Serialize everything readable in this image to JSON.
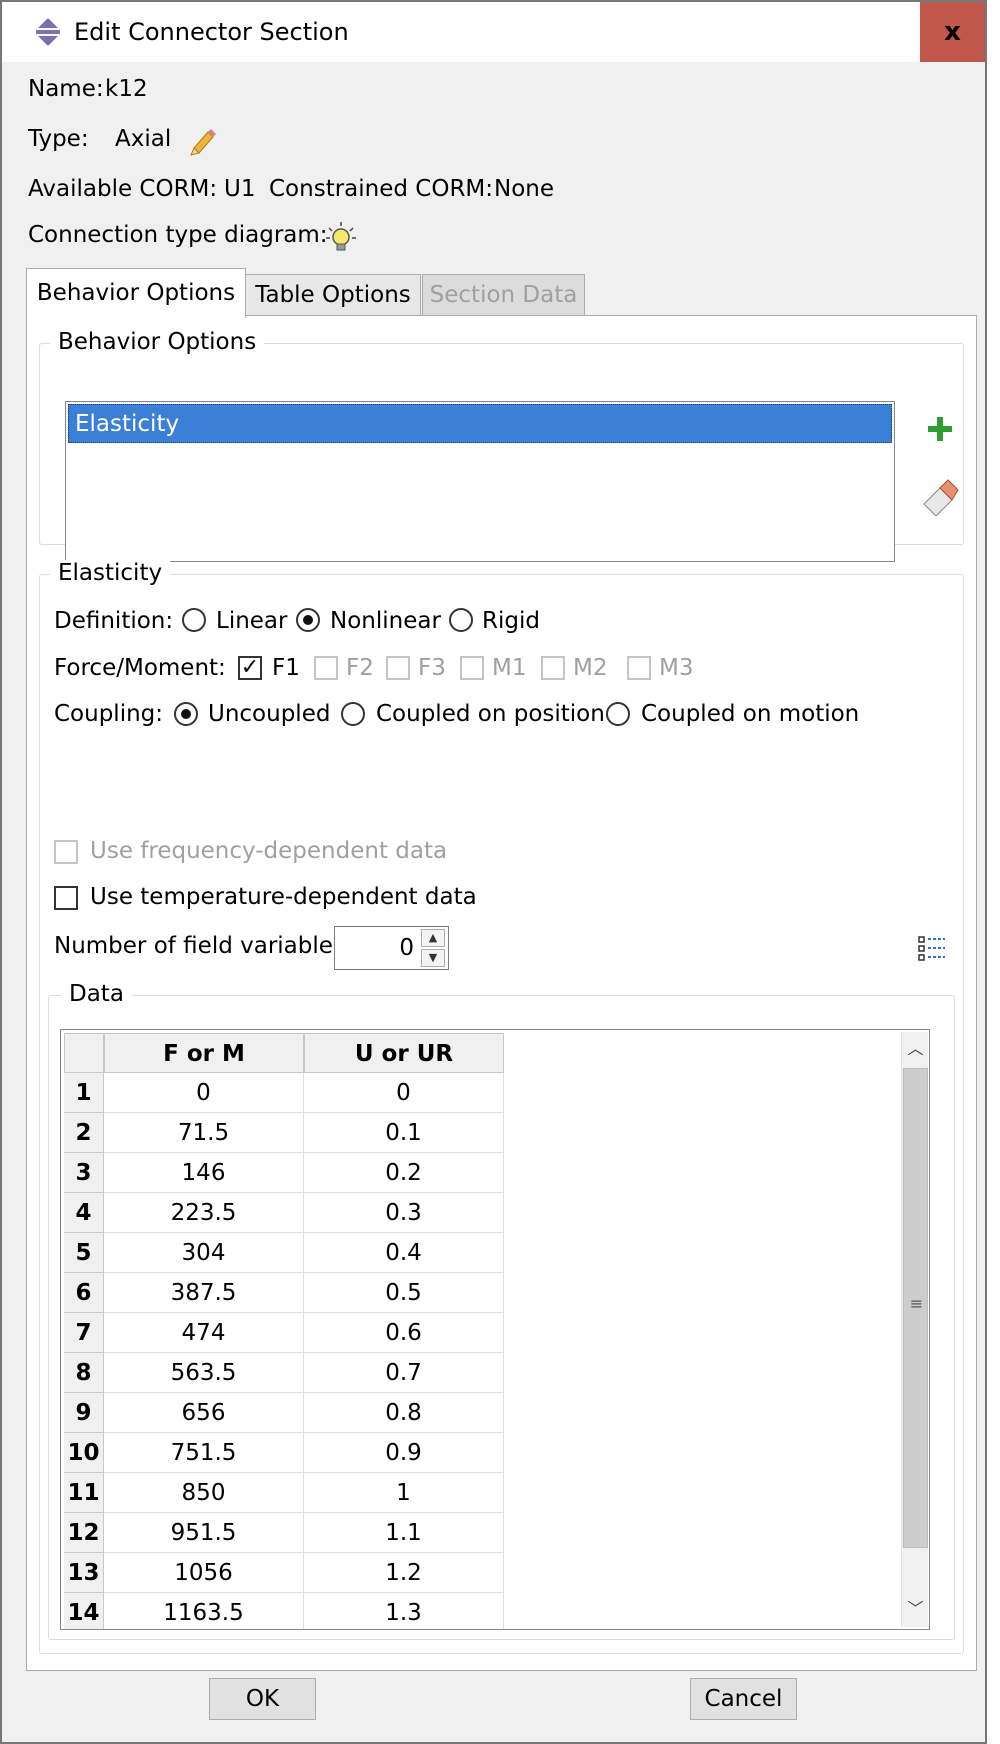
{
  "window": {
    "title": "Edit Connector Section",
    "close_label": "x"
  },
  "info": {
    "name_label": "Name:",
    "name_value": "k12",
    "type_label": "Type:",
    "type_value": "Axial",
    "available_corm_label": "Available CORM:",
    "available_corm_value": "U1",
    "constrained_corm_label": "Constrained CORM:",
    "constrained_corm_value": "None",
    "diagram_label": "Connection type diagram:"
  },
  "tabs": [
    {
      "label": "Behavior Options",
      "active": true,
      "enabled": true
    },
    {
      "label": "Table Options",
      "active": false,
      "enabled": true
    },
    {
      "label": "Section Data",
      "active": false,
      "enabled": false
    }
  ],
  "behavior_options": {
    "group_title": "Behavior Options",
    "items": [
      "Elasticity"
    ],
    "selected": "Elasticity"
  },
  "elasticity": {
    "group_title": "Elasticity",
    "definition_label": "Definition:",
    "definition_options": [
      "Linear",
      "Nonlinear",
      "Rigid"
    ],
    "definition_selected": "Nonlinear",
    "force_moment_label": "Force/Moment:",
    "force_moment_options": [
      {
        "label": "F1",
        "checked": true,
        "enabled": true
      },
      {
        "label": "F2",
        "checked": false,
        "enabled": false
      },
      {
        "label": "F3",
        "checked": false,
        "enabled": false
      },
      {
        "label": "M1",
        "checked": false,
        "enabled": false
      },
      {
        "label": "M2",
        "checked": false,
        "enabled": false
      },
      {
        "label": "M3",
        "checked": false,
        "enabled": false
      }
    ],
    "coupling_label": "Coupling:",
    "coupling_options": [
      "Uncoupled",
      "Coupled on position",
      "Coupled on motion"
    ],
    "coupling_selected": "Uncoupled",
    "freq_dependent_label": "Use frequency-dependent data",
    "freq_dependent_checked": false,
    "freq_dependent_enabled": false,
    "temp_dependent_label": "Use temperature-dependent data",
    "temp_dependent_checked": false,
    "field_vars_label": "Number of field variables:",
    "field_vars_value": "0"
  },
  "data": {
    "group_title": "Data",
    "columns": [
      "F or M",
      "U or UR"
    ],
    "rows": [
      {
        "n": "1",
        "f": "0",
        "u": "0"
      },
      {
        "n": "2",
        "f": "71.5",
        "u": "0.1"
      },
      {
        "n": "3",
        "f": "146",
        "u": "0.2"
      },
      {
        "n": "4",
        "f": "223.5",
        "u": "0.3"
      },
      {
        "n": "5",
        "f": "304",
        "u": "0.4"
      },
      {
        "n": "6",
        "f": "387.5",
        "u": "0.5"
      },
      {
        "n": "7",
        "f": "474",
        "u": "0.6"
      },
      {
        "n": "8",
        "f": "563.5",
        "u": "0.7"
      },
      {
        "n": "9",
        "f": "656",
        "u": "0.8"
      },
      {
        "n": "10",
        "f": "751.5",
        "u": "0.9"
      },
      {
        "n": "11",
        "f": "850",
        "u": "1"
      },
      {
        "n": "12",
        "f": "951.5",
        "u": "1.1"
      },
      {
        "n": "13",
        "f": "1056",
        "u": "1.2"
      },
      {
        "n": "14",
        "f": "1163.5",
        "u": "1.3"
      }
    ]
  },
  "buttons": {
    "ok": "OK",
    "cancel": "Cancel"
  },
  "colors": {
    "selection": "#3c7fd6",
    "close_button": "#c0574b",
    "add_icon": "#2e9e2e"
  }
}
